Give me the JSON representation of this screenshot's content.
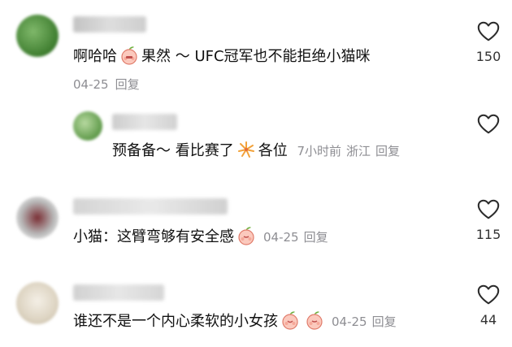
{
  "comments": [
    {
      "username": "湾湾不知道",
      "text_a": "啊哈哈",
      "emoji": "grimace-peach-emoji",
      "text_b": "果然 ～ UFC冠军也不能拒绝小猫咪",
      "date": "04-25",
      "reply": "回复",
      "likes": "150"
    },
    {
      "username": "老六不知道",
      "text_a": "预备备～  看比赛了",
      "emoji": "fireworks-emoji",
      "text_b": "各位",
      "time": "7小时前",
      "location": "浙江",
      "reply": "回复"
    },
    {
      "username": "啦啦啦啦啦码",
      "text_a": "小猫：这臂弯够有安全感",
      "emoji": "shy-peach-emoji",
      "date": "04-25",
      "reply": "回复",
      "likes": "115"
    },
    {
      "username": "小糖糖 dot",
      "text_a": "谁还不是一个内心柔软的小女孩",
      "emoji": "smile-peach-emoji",
      "emoji2": "shy-peach-emoji",
      "date": "04-25",
      "reply": "回复",
      "likes": "44"
    }
  ],
  "colors": {
    "text": "#111111",
    "meta": "#8e8e93",
    "heart": "#2b2b2b"
  }
}
